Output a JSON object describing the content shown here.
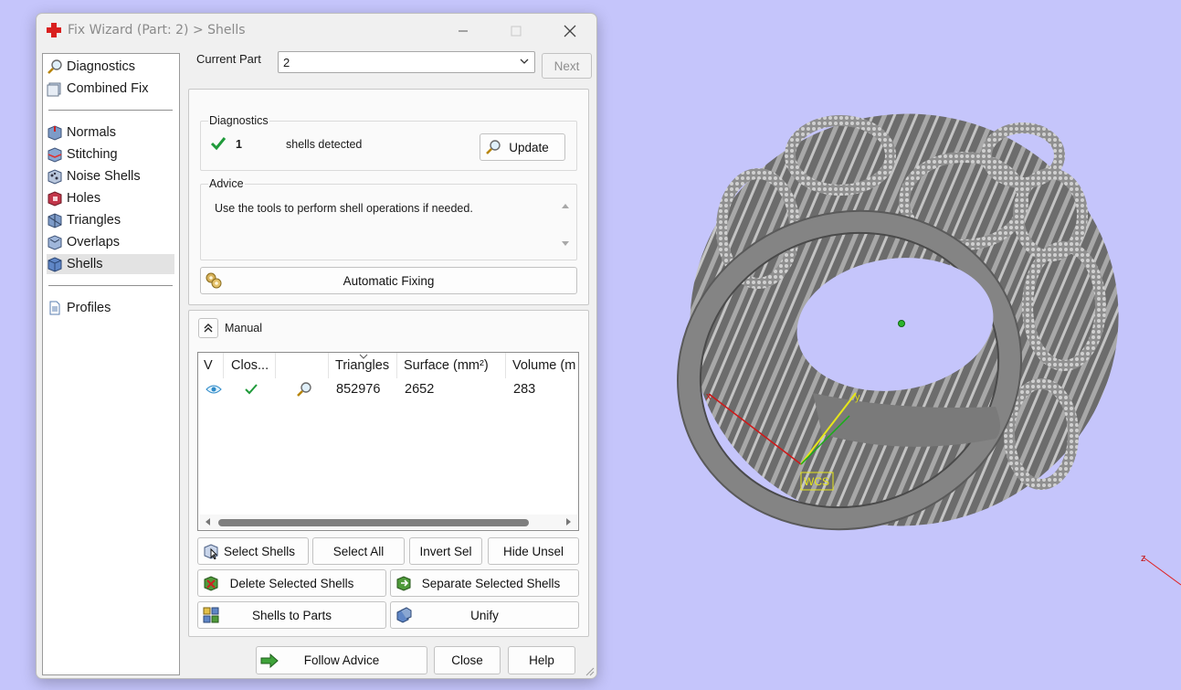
{
  "window": {
    "title": "Fix Wizard (Part: 2) > Shells",
    "minimize_icon": "minimize-icon",
    "maximize_icon": "maximize-icon",
    "close_icon": "close-icon"
  },
  "sidebar": {
    "items": [
      {
        "label": "Diagnostics",
        "icon": "magnifier-icon"
      },
      {
        "label": "Combined Fix",
        "icon": "cube-stack-icon"
      },
      {
        "label": "Normals",
        "icon": "normals-cube-icon"
      },
      {
        "label": "Stitching",
        "icon": "stitching-cube-icon"
      },
      {
        "label": "Noise Shells",
        "icon": "noise-cube-icon"
      },
      {
        "label": "Holes",
        "icon": "holes-cube-icon"
      },
      {
        "label": "Triangles",
        "icon": "triangles-cube-icon"
      },
      {
        "label": "Overlaps",
        "icon": "overlaps-cube-icon"
      },
      {
        "label": "Shells",
        "icon": "shells-cube-icon",
        "selected": true
      },
      {
        "label": "Profiles",
        "icon": "document-icon"
      }
    ]
  },
  "current_part": {
    "label": "Current Part",
    "value": "2",
    "next_label": "Next"
  },
  "diagnostics": {
    "title": "Diagnostics",
    "count": "1",
    "text": "shells detected",
    "update_label": "Update"
  },
  "advice": {
    "title": "Advice",
    "text": "Use the tools to perform shell operations if needed."
  },
  "automatic_fixing_label": "Automatic Fixing",
  "manual": {
    "label": "Manual",
    "columns": [
      "V",
      "Clos...",
      "",
      "Triangles",
      "Surface (mm²)",
      "Volume (m"
    ],
    "row": {
      "visible_icon": "eye-icon",
      "closed_icon": "checkmark-icon",
      "inspect_icon": "magnifier-icon",
      "triangles": "852976",
      "surface": "2652",
      "volume": "283"
    }
  },
  "actions": {
    "select_shells": "Select Shells",
    "select_all": "Select All",
    "invert_sel": "Invert Sel",
    "hide_unsel": "Hide Unsel",
    "delete_selected": "Delete Selected Shells",
    "separate_selected": "Separate Selected Shells",
    "shells_to_parts": "Shells to Parts",
    "unify": "Unify"
  },
  "footer": {
    "follow_advice": "Follow Advice",
    "close": "Close",
    "help": "Help"
  },
  "viewport": {
    "wcs_label": "WCS",
    "axis_x": "x",
    "axis_y": "y",
    "axis_z": "z",
    "background_color": "#c5c5fb",
    "model_color": "#8c8c8c"
  },
  "colors": {
    "check_green": "#1f9a3a",
    "accent_red": "#d9201f"
  }
}
